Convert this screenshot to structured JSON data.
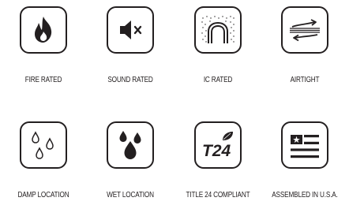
{
  "badges": [
    {
      "label": "FIRE RATED",
      "icon": "flame-icon"
    },
    {
      "label": "SOUND RATED",
      "icon": "speaker-muted-icon"
    },
    {
      "label": "IC RATED",
      "icon": "insulation-contact-icon"
    },
    {
      "label": "AIRTIGHT",
      "icon": "airflow-icon"
    },
    {
      "label": "DAMP LOCATION",
      "icon": "outline-droplets-icon"
    },
    {
      "label": "WET LOCATION",
      "icon": "solid-droplets-icon"
    },
    {
      "label": "TITLE 24 COMPLIANT",
      "icon": "title-24-leaf-icon",
      "icon_text": "T24"
    },
    {
      "label": "ASSEMBLED IN U.S.A.",
      "icon": "us-flag-icon"
    }
  ],
  "colors": {
    "ink": "#231f20",
    "background": "#ffffff"
  }
}
